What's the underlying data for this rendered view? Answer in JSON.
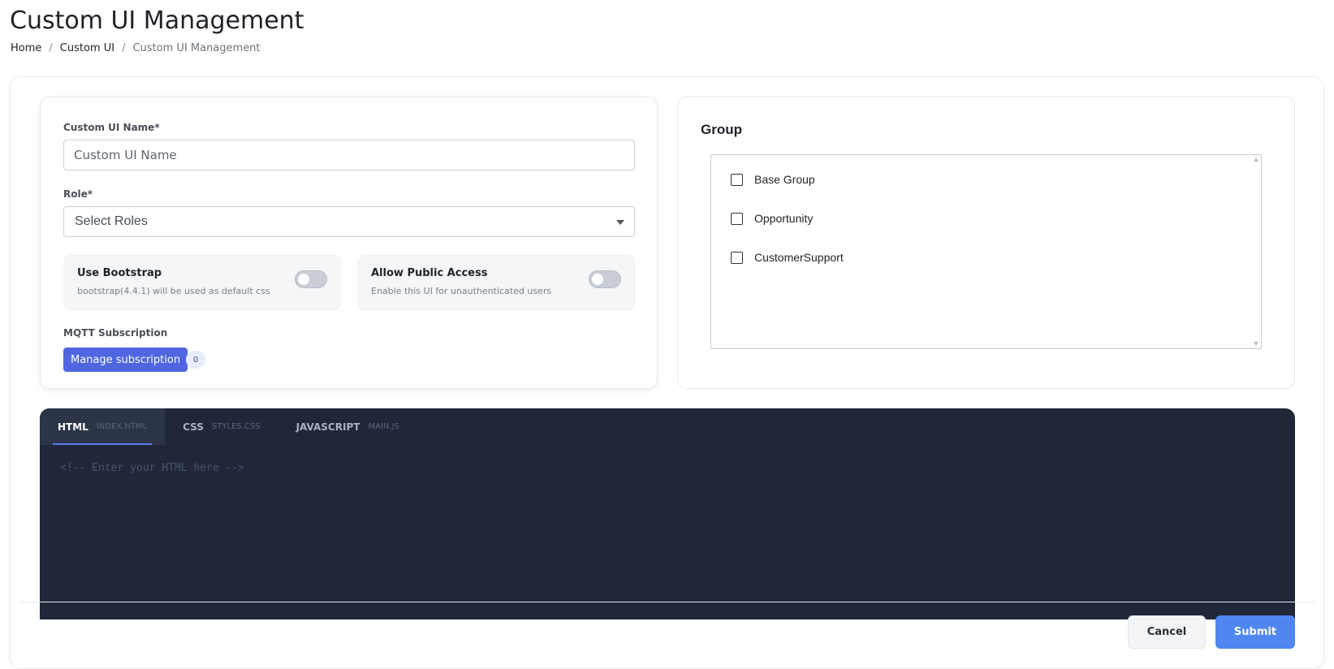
{
  "header": {
    "title": "Custom UI Management",
    "breadcrumb": {
      "home": "Home",
      "section": "Custom UI",
      "current": "Custom UI Management",
      "separator": "/"
    }
  },
  "form": {
    "name_label": "Custom UI Name*",
    "name_placeholder": "Custom UI Name",
    "role_label": "Role*",
    "role_placeholder": "Select Roles",
    "bootstrap": {
      "title": "Use Bootstrap",
      "description": "bootstrap(4.4.1) will be used as default css",
      "enabled": false
    },
    "public_access": {
      "title": "Allow Public Access",
      "description": "Enable this UI for unauthenticated users",
      "enabled": false
    },
    "mqtt": {
      "label": "MQTT Subscription",
      "button_label": "Manage subscription",
      "count": "0"
    }
  },
  "group": {
    "title": "Group",
    "items": [
      {
        "label": "Base Group",
        "checked": false
      },
      {
        "label": "Opportunity",
        "checked": false
      },
      {
        "label": "CustomerSupport",
        "checked": false
      }
    ]
  },
  "editor": {
    "tabs": [
      {
        "name": "HTML",
        "file": "INDEX.HTML",
        "active": true
      },
      {
        "name": "CSS",
        "file": "STYLES.CSS",
        "active": false
      },
      {
        "name": "JAVASCRIPT",
        "file": "MAIN.JS",
        "active": false
      }
    ],
    "placeholder": "<!-- Enter your HTML here -->"
  },
  "footer": {
    "cancel_label": "Cancel",
    "submit_label": "Submit"
  },
  "colors": {
    "primary": "#4f66e0",
    "submit": "#4f86f2",
    "editor_bg": "#1f2739",
    "tab_active_underline": "#5a7bf0"
  }
}
